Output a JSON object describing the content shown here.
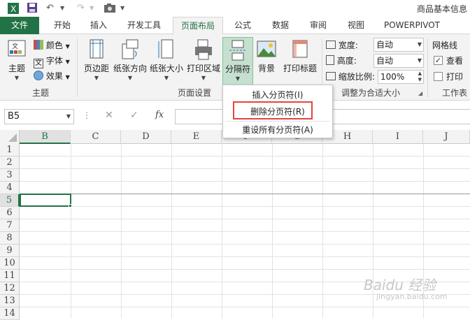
{
  "window": {
    "title": "商品基本信息"
  },
  "tabs": [
    {
      "label": "文件"
    },
    {
      "label": "开始"
    },
    {
      "label": "插入"
    },
    {
      "label": "开发工具"
    },
    {
      "label": "页面布局"
    },
    {
      "label": "公式"
    },
    {
      "label": "数据"
    },
    {
      "label": "审阅"
    },
    {
      "label": "视图"
    },
    {
      "label": "POWERPIVOT"
    }
  ],
  "ribbon": {
    "theme_group": {
      "label": "主题",
      "themes": "主题",
      "colors": "颜色",
      "fonts": "字体",
      "effects": "效果"
    },
    "page_setup_group": {
      "label": "页面设置",
      "margins": "页边距",
      "orientation": "纸张方向",
      "size": "纸张大小",
      "print_area": "打印区域",
      "breaks": "分隔符",
      "background": "背景",
      "print_titles": "打印标题"
    },
    "scale_group": {
      "label": "调整为合适大小",
      "width_label": "宽度:",
      "width_value": "自动",
      "height_label": "高度:",
      "height_value": "自动",
      "scale_label": "缩放比例:",
      "scale_value": "100%"
    },
    "sheet_options_group": {
      "label": "工作表",
      "gridlines": "网格线",
      "view": "查看",
      "print": "打印"
    }
  },
  "formula_bar": {
    "name_box": "B5",
    "fx": "fx"
  },
  "grid": {
    "columns": [
      "B",
      "C",
      "D",
      "E",
      "F",
      "G",
      "H",
      "I",
      "J"
    ],
    "rows": [
      "1",
      "2",
      "3",
      "4",
      "5",
      "6",
      "7",
      "8",
      "9",
      "10",
      "11",
      "12",
      "13",
      "14"
    ],
    "selected_cell": "B5"
  },
  "breaks_menu": {
    "items": [
      {
        "label": "插入分页符(I)"
      },
      {
        "label": "删除分页符(R)"
      },
      {
        "label": "重设所有分页符(A)"
      }
    ]
  },
  "watermark": {
    "text": "Baidu 经验",
    "url_text": "jingyan.baidu.com"
  },
  "colors": {
    "accent": "#217346",
    "highlight_box": "#e2463c"
  }
}
